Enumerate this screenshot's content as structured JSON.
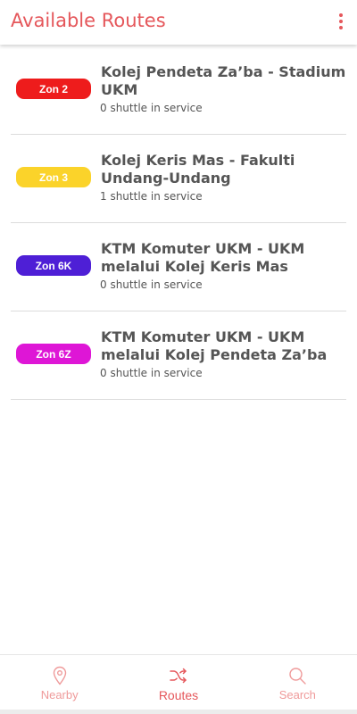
{
  "app_bar": {
    "title": "Available Routes",
    "overflow_icon": "more-vert-icon"
  },
  "colors": {
    "accent": "#e5575b",
    "inactive_nav": "#ef9a9a",
    "text": "#555555"
  },
  "routes": [
    {
      "zone": "Zon 2",
      "zone_color": "#ee1c1c",
      "name": "Kolej Pendeta Za’ba - Stadium UKM",
      "status": "0 shuttle in service"
    },
    {
      "zone": "Zon 3",
      "zone_color": "#fbd32a",
      "name": "Kolej Keris Mas - Fakulti Undang-Undang",
      "status": "1 shuttle in service"
    },
    {
      "zone": "Zon 6K",
      "zone_color": "#4e1fd6",
      "name": "KTM Komuter UKM - UKM melalui Kolej Keris Mas",
      "status": "0 shuttle in service"
    },
    {
      "zone": "Zon 6Z",
      "zone_color": "#de16d6",
      "name": "KTM Komuter UKM - UKM melalui Kolej Pendeta Za’ba",
      "status": "0 shuttle in service"
    }
  ],
  "bottom_nav": {
    "items": [
      {
        "label": "Nearby",
        "icon": "location-pin-icon",
        "active": false
      },
      {
        "label": "Routes",
        "icon": "shuffle-icon",
        "active": true
      },
      {
        "label": "Search",
        "icon": "search-icon",
        "active": false
      }
    ]
  }
}
